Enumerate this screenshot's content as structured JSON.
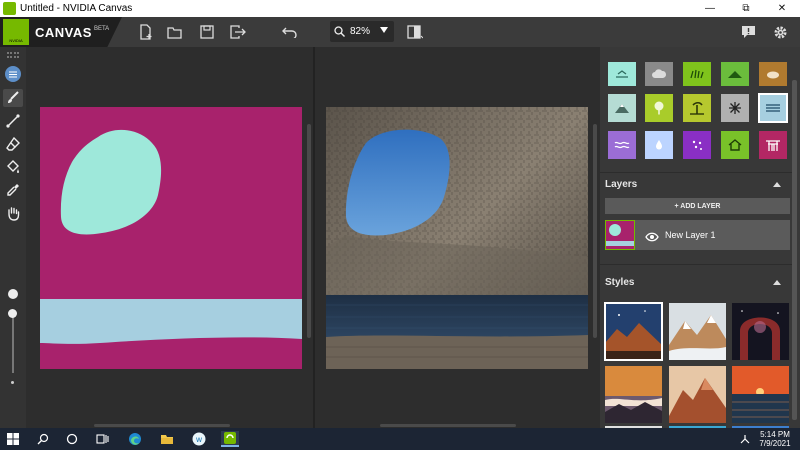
{
  "window": {
    "title": "Untitled - NVIDIA Canvas"
  },
  "brand": {
    "name": "CANVAS",
    "badge": "BETA",
    "logo_text": "NVIDIA"
  },
  "toolbar": {
    "zoom_value": "82%",
    "icons": [
      "new-file-icon",
      "open-folder-icon",
      "save-icon",
      "export-icon",
      "undo-icon",
      "search-icon",
      "split-view-icon",
      "chat-icon",
      "gear-icon"
    ]
  },
  "tools": [
    "materials-tool",
    "brush-tool",
    "line-tool",
    "eraser-tool",
    "fill-tool",
    "eyedropper-tool",
    "pan-tool"
  ],
  "colors": {
    "accent": "#76b900",
    "paint_background": "#a8226c",
    "sky_material": "#9ee8da",
    "water_material": "#a6cfe0"
  },
  "materials": [
    {
      "name": "mat-sky-sea",
      "color": "#9ee8da"
    },
    {
      "name": "mat-cloud",
      "color": "#8a8a8a"
    },
    {
      "name": "mat-grass",
      "color": "#7fc31c"
    },
    {
      "name": "mat-hill",
      "color": "#6bbd3c"
    },
    {
      "name": "mat-rock-brown",
      "color": "#b07a2f"
    },
    {
      "name": "mat-mountain",
      "color": "#b5dcd4"
    },
    {
      "name": "mat-tree",
      "color": "#a9cc2a"
    },
    {
      "name": "mat-bush",
      "color": "#b6c82e"
    },
    {
      "name": "mat-snow",
      "color": "#b0b0b0"
    },
    {
      "name": "mat-water",
      "color": "#a6cfe0"
    },
    {
      "name": "mat-river",
      "color": "#9b6dd6"
    },
    {
      "name": "mat-fog",
      "color": "#bcd4ff"
    },
    {
      "name": "mat-flowers",
      "color": "#8a2fc4"
    },
    {
      "name": "mat-house",
      "color": "#79c229"
    },
    {
      "name": "mat-temple",
      "color": "#b32764"
    }
  ],
  "layers": {
    "title": "Layers",
    "add_label": "+ ADD LAYER",
    "items": [
      {
        "name": "New Layer 1"
      }
    ]
  },
  "styles": {
    "title": "Styles",
    "thumbs": [
      "style-mountain-night",
      "style-snowy-peaks",
      "style-rock-arch-stars",
      "style-sunset-fog",
      "style-red-mountain",
      "style-ocean-sunset"
    ]
  },
  "taskbar": {
    "time": "5:14 PM",
    "date": "7/9/2021",
    "icons": [
      "windows-start-icon",
      "search-icon",
      "cortana-icon",
      "task-view-icon",
      "edge-icon",
      "file-explorer-icon",
      "wink-icon",
      "canvas-app-icon",
      "network-icon"
    ]
  }
}
